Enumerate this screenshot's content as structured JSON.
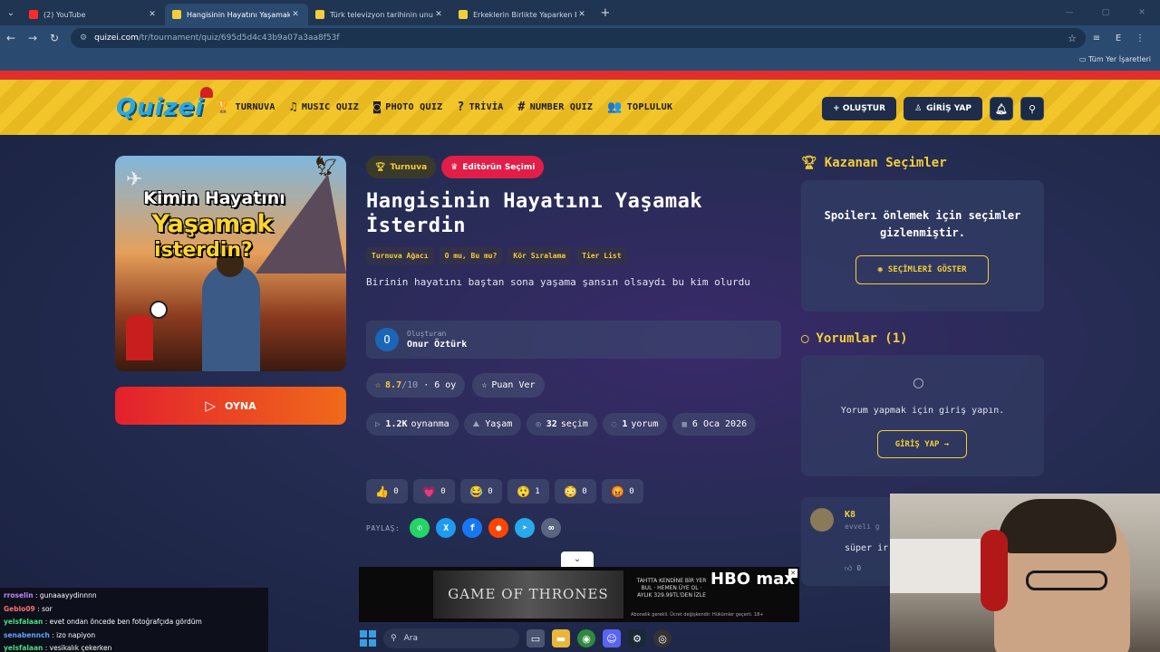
{
  "browser": {
    "tabs": [
      {
        "title": "(2) YouTube",
        "favicon_color": "#ff2a2a",
        "active": false
      },
      {
        "title": "Hangisinin Hayatını Yaşamak İst",
        "favicon_color": "#f3cd3a",
        "active": true
      },
      {
        "title": "Türk televizyon tarihinin unutul",
        "favicon_color": "#f3cd3a",
        "active": false
      },
      {
        "title": "Erkeklerin Birlikte Yaparken En",
        "favicon_color": "#f3cd3a",
        "active": false
      }
    ],
    "url_site": "quizei.com",
    "url_path": "/tr/tournament/quiz/695d5d4c43b9a07a3aa8f53f",
    "bookmarks_label": "Tüm Yer İşaretleri"
  },
  "header": {
    "logo": "Quizei",
    "nav": [
      {
        "label": "TURNUVA",
        "icon": "trophy-icon",
        "glyph": "🏆"
      },
      {
        "label": "MUSIC QUIZ",
        "icon": "music-icon",
        "glyph": "♫"
      },
      {
        "label": "PHOTO QUIZ",
        "icon": "camera-icon",
        "glyph": "◙"
      },
      {
        "label": "TRİVİA",
        "icon": "question-icon",
        "glyph": "?"
      },
      {
        "label": "NUMBER QUIZ",
        "icon": "hash-icon",
        "glyph": "#"
      },
      {
        "label": "TOPLULUK",
        "icon": "users-icon",
        "glyph": "👥"
      }
    ],
    "create_label": "+ OLUŞTUR",
    "login_label": "GİRİŞ YAP"
  },
  "quiz": {
    "cover_lines": [
      "Kimin Hayatını",
      "Yaşamak",
      "isterdin?"
    ],
    "play_label": "OYNA",
    "badges": [
      "Turnuva",
      "Editörün Seçimi"
    ],
    "title": "Hangisinin Hayatını Yaşamak İsterdin",
    "tags": [
      "Turnuva Ağacı",
      "O mu, Bu mu?",
      "Kör Sıralama",
      "Tier List"
    ],
    "description": "Birinin hayatını baştan sona yaşama şansın olsaydı bu kim olurdu",
    "creator_label": "Oluşturan",
    "creator_initial": "O",
    "creator_name": "Onur Öztürk",
    "rating": "8.7",
    "rating_max": "/10",
    "votes": "· 6 oy",
    "rate_label": "Puan Ver",
    "stats": [
      {
        "icon": "play-icon",
        "glyph": "▷",
        "value": "1.2K",
        "label": "oynanma"
      },
      {
        "icon": "category-icon",
        "glyph": "⛰",
        "value": "",
        "label": "Yaşam"
      },
      {
        "icon": "layers-icon",
        "glyph": "◎",
        "value": "32",
        "label": "seçim"
      },
      {
        "icon": "comment-icon",
        "glyph": "◌",
        "value": "1",
        "label": "yorum"
      },
      {
        "icon": "calendar-icon",
        "glyph": "▦",
        "value": "",
        "label": "6 Oca 2026"
      }
    ],
    "reactions": [
      {
        "emoji": "👍",
        "count": "0",
        "name": "like-reaction"
      },
      {
        "emoji": "💗",
        "count": "0",
        "name": "love-reaction"
      },
      {
        "emoji": "😂",
        "count": "0",
        "name": "laugh-reaction"
      },
      {
        "emoji": "😲",
        "count": "1",
        "name": "wow-reaction"
      },
      {
        "emoji": "😳",
        "count": "0",
        "name": "shock-reaction"
      },
      {
        "emoji": "😡",
        "count": "0",
        "name": "angry-reaction"
      }
    ],
    "share_label": "PAYLAŞ:",
    "share": [
      {
        "name": "whatsapp-icon",
        "glyph": "✆",
        "color": "#25d366"
      },
      {
        "name": "x-icon",
        "glyph": "X",
        "color": "#1d9bf0"
      },
      {
        "name": "facebook-icon",
        "glyph": "f",
        "color": "#1877f2"
      },
      {
        "name": "reddit-icon",
        "glyph": "●",
        "color": "#ff4500"
      },
      {
        "name": "telegram-icon",
        "glyph": "➤",
        "color": "#29a9eb"
      },
      {
        "name": "link-icon",
        "glyph": "∞",
        "color": "#5a6580"
      }
    ]
  },
  "sidebar": {
    "winners_title": "Kazanan Seçimler",
    "spoiler_text": "Spoilerı önlemek için seçimler gizlenmiştir.",
    "show_button": "SEÇİMLERİ GÖSTER",
    "comments_title": "Yorumlar (1)",
    "comment_prompt": "Yorum yapmak için giriş yapın.",
    "comment_login": "GİRİŞ YAP →",
    "comment": {
      "user": "K8",
      "time": "evveli g",
      "text": "süper ir",
      "likes": "0"
    }
  },
  "ad": {
    "show": "GAME OF THRONES",
    "offer": "TAHTTA KENDİNE BİR YER BUL · HEMEN ÜYE OL · AYLIK 329.99TL'DEN İZLE",
    "brand": "HBO max",
    "fine": "Abonelik gerekli. Ücret değişkendir. Hükümler geçerli. 18+"
  },
  "chat": [
    {
      "user": "rroselin",
      "color": "#c084fc",
      "msg": "gunaaayydinnnn"
    },
    {
      "user": "Geblo09",
      "color": "#f87171",
      "msg": "sor"
    },
    {
      "user": "yelsfalaan",
      "color": "#4ade80",
      "msg": "evet ondan öncede ben fotoğrafçıda gördüm"
    },
    {
      "user": "senabennch",
      "color": "#60a5fa",
      "msg": "izo napiyon"
    },
    {
      "user": "yelsfalaan",
      "color": "#4ade80",
      "msg": "vesikalık çekerken"
    }
  ],
  "taskbar": {
    "search_label": "Ara"
  }
}
